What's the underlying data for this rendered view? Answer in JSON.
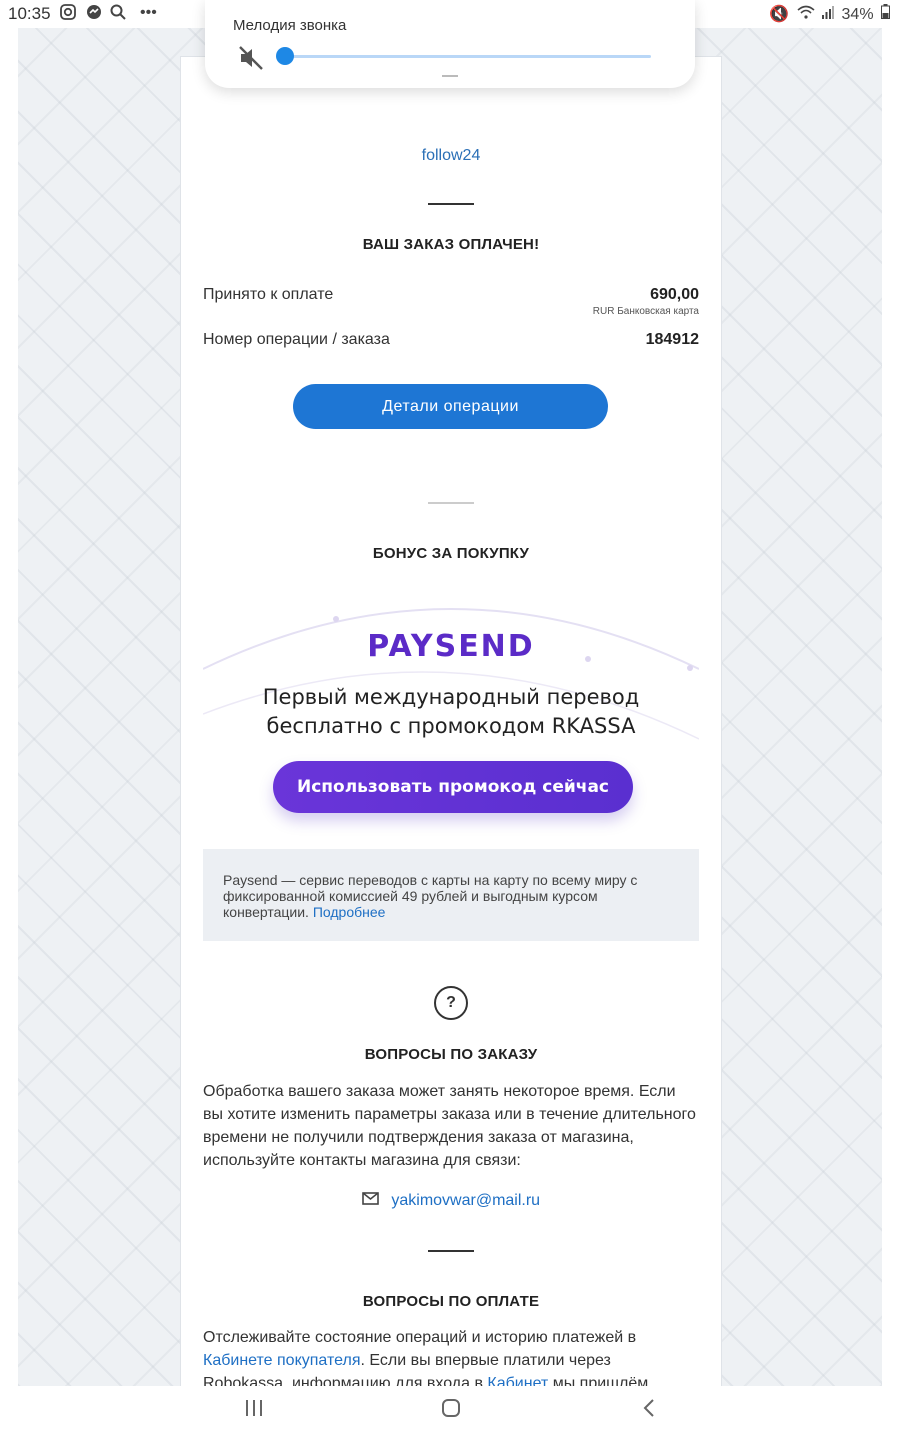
{
  "status_bar": {
    "time": "10:35",
    "battery": "34%",
    "icons": [
      "instagram-icon",
      "messenger-icon",
      "search-icon",
      "more-icon",
      "mute-icon",
      "wifi-icon",
      "signal-icon",
      "battery-icon"
    ]
  },
  "volume_popup": {
    "label": "Мелодия звонка",
    "level": 0
  },
  "email": {
    "shop_name": "follow24",
    "paid_title": "ВАШ ЗАКАЗ ОПЛАЧЕН!",
    "payment_rows": [
      {
        "label": "Принято к оплате",
        "value": "690,00",
        "sub": "RUR Банковская карта"
      },
      {
        "label": "Номер операции / заказа",
        "value": "184912"
      }
    ],
    "details_button": "Детали операции",
    "bonus_title": "БОНУС ЗА ПОКУПКУ",
    "banner": {
      "logo": "PAYSEND",
      "line1": "Первый международный перевод",
      "line2": "бесплатно с промокодом RKASSA",
      "button": "Использовать промокод сейчас"
    },
    "info": {
      "text": "Paysend — сервис переводов с карты на карту по всему миру с фиксированной комиссией 49 рублей и выгодным курсом конвертации.",
      "link": "Подробнее"
    },
    "order_questions": {
      "title": "ВОПРОСЫ ПО ЗАКАЗУ",
      "text": "Обработка вашего заказа может занять некоторое время. Если вы хотите изменить параметры заказа или в течение длительного времени не получили подтверждения заказа от магазина, используйте контакты магазина для связи:",
      "contact_email": "yakimovwar@mail.ru"
    },
    "payment_questions": {
      "title": "ВОПРОСЫ ПО ОПЛАТЕ",
      "text_before_link": "Отслеживайте состояние операций и историю платежей в",
      "link1": "Кабинете покупателя",
      "text_middle": ". Если вы впервые платили через Robokassa, информацию для входа в",
      "link2": "Кабинет",
      "text_after": "мы пришлём"
    }
  },
  "colors": {
    "accent_blue": "#1e76d4",
    "paysend_purple": "#5b2bc7",
    "link": "#1e6fc4"
  }
}
